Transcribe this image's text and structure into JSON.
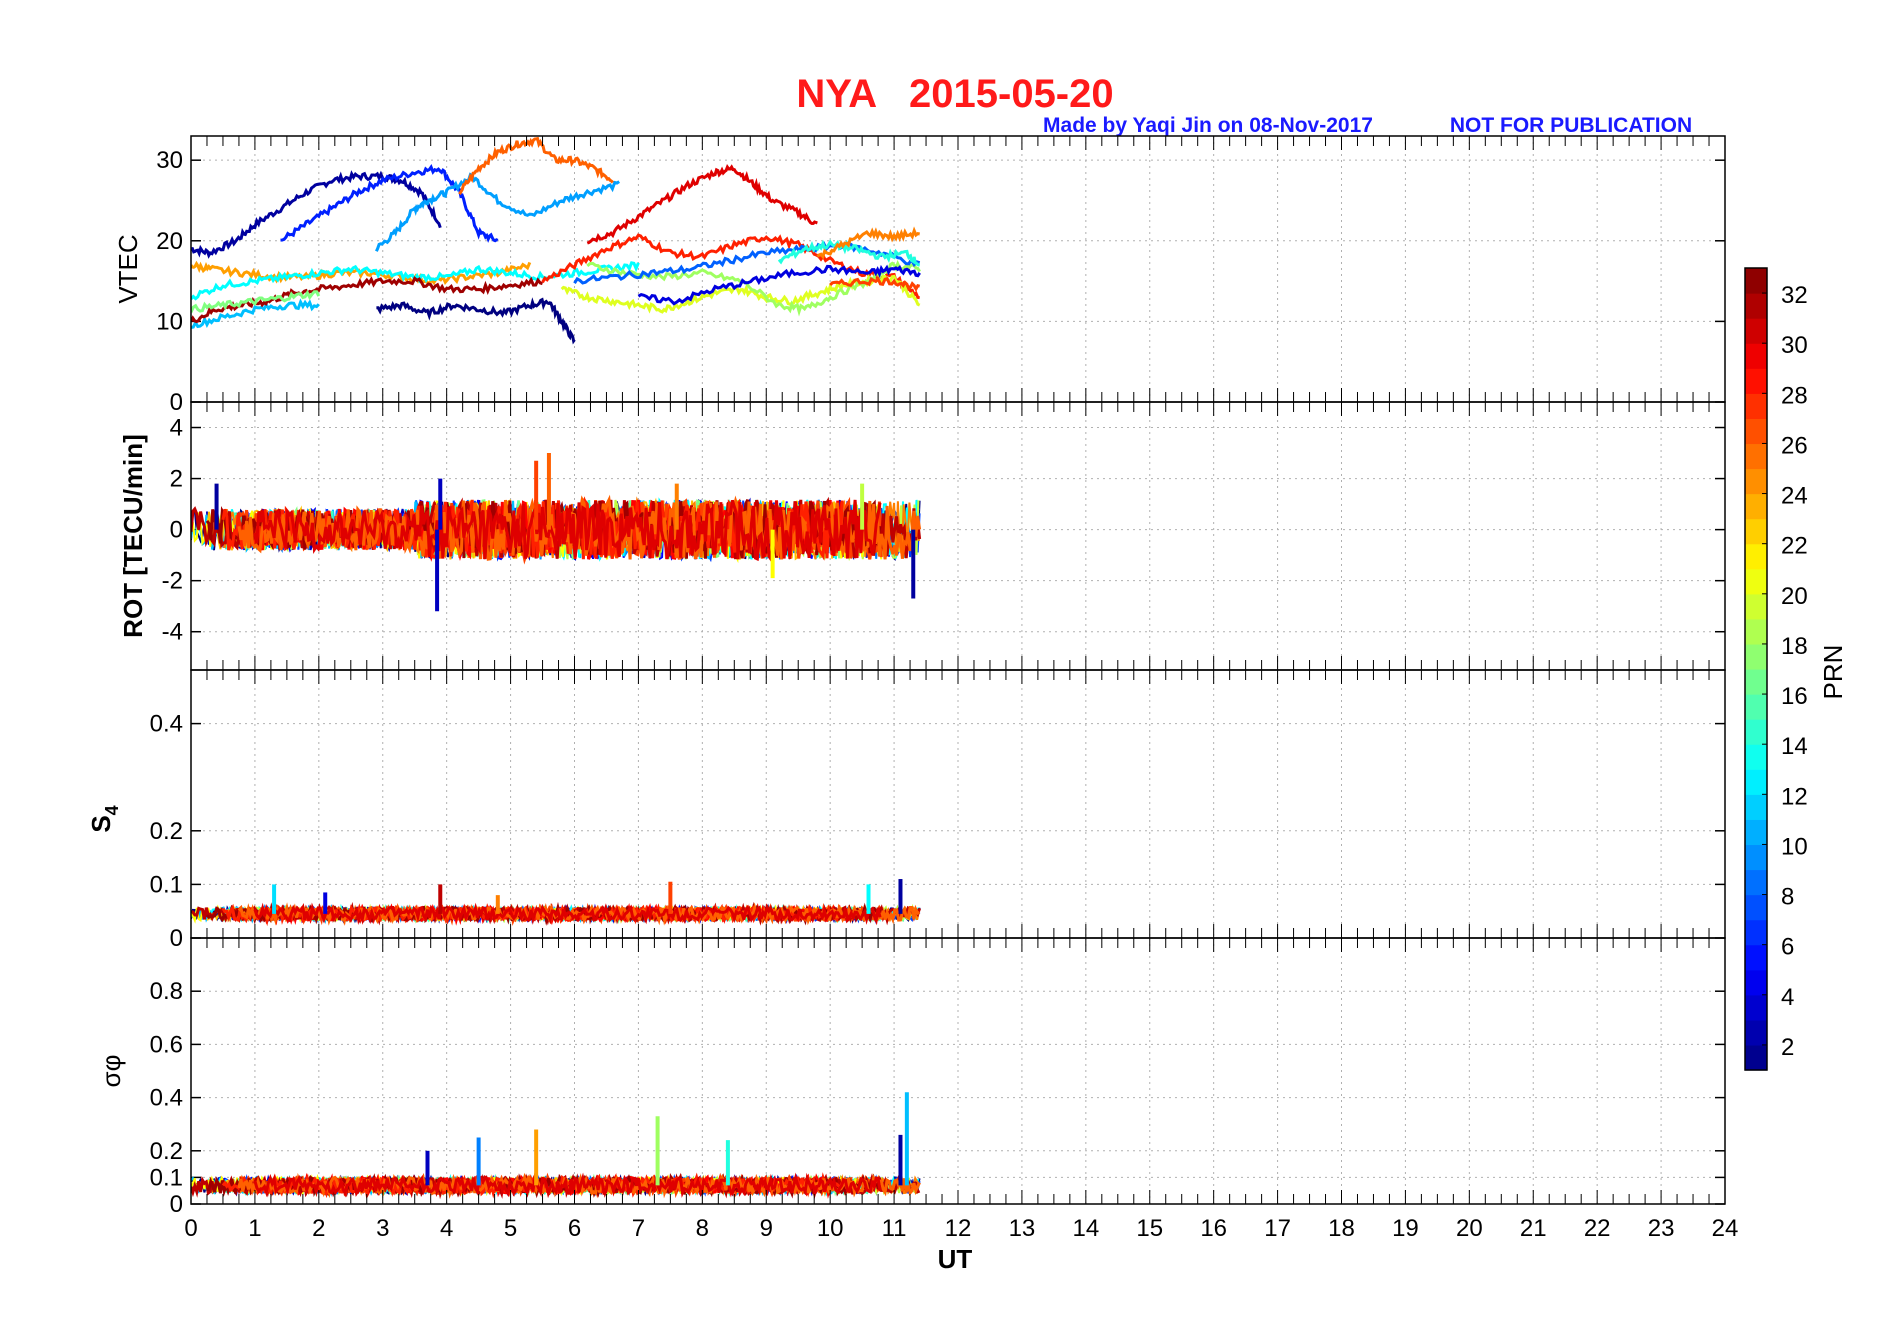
{
  "header": {
    "title": "NYA   2015-05-20",
    "credit": "Made by Yaqi Jin on 08-Nov-2017",
    "notice": "NOT FOR PUBLICATION"
  },
  "colors": {
    "title": "#ff1a1a",
    "credit": "#1a1aff",
    "frame": "#000000",
    "grid": "#b0b0b0"
  },
  "colormap": "jet",
  "chart_data": [
    {
      "type": "line",
      "ylabel": "VTEC",
      "x_range": [
        0,
        24
      ],
      "ylim": [
        0,
        33
      ],
      "yticks": [
        "0",
        "10",
        "20",
        "30"
      ],
      "grid": true,
      "series_description": "VTEC per PRN, colored by PRN, data from 0 to ~11.4 UT",
      "series": [
        {
          "prn": 2,
          "x": [
            0,
            0.3,
            0.7,
            1.0,
            1.4,
            1.8,
            2.2,
            2.6,
            3.0,
            3.3,
            3.6,
            3.9
          ],
          "y": [
            19,
            18.5,
            20,
            22,
            24,
            26,
            27.5,
            28,
            28,
            27.5,
            26,
            22
          ]
        },
        {
          "prn": 6,
          "x": [
            1.4,
            1.8,
            2.2,
            2.6,
            3.0,
            3.5,
            3.9,
            4.2,
            4.5,
            4.8
          ],
          "y": [
            20,
            22,
            24,
            26,
            27.5,
            28.5,
            29,
            26,
            21,
            20
          ]
        },
        {
          "prn": 10,
          "x": [
            2.9,
            3.2,
            3.5,
            3.7,
            4.0,
            4.4,
            4.8,
            5.3,
            5.8,
            6.2,
            6.7
          ],
          "y": [
            19,
            21,
            24,
            25,
            26,
            28,
            25,
            23,
            25,
            26,
            27
          ]
        },
        {
          "prn": 26,
          "x": [
            4.2,
            4.5,
            4.8,
            5.1,
            5.4,
            5.7,
            6.0,
            6.3,
            6.6
          ],
          "y": [
            26,
            29,
            31,
            32,
            32.5,
            30,
            30,
            29,
            27.5
          ]
        },
        {
          "prn": 30,
          "x": [
            6.2,
            6.6,
            7.0,
            7.4,
            7.8,
            8.2,
            8.5,
            8.8,
            9.1,
            9.5,
            9.8
          ],
          "y": [
            20,
            21,
            23,
            25,
            27,
            28.5,
            29,
            27,
            25,
            23.5,
            22
          ]
        },
        {
          "prn": 1,
          "x": [
            2.9,
            3.3,
            3.7,
            4.1,
            4.5,
            4.9,
            5.3,
            5.6,
            5.8,
            6.0
          ],
          "y": [
            11.5,
            12,
            11,
            12,
            11.5,
            11,
            12,
            12.5,
            10,
            7.5
          ]
        },
        {
          "prn": 24,
          "x": [
            0,
            0.3,
            0.8,
            1.3,
            1.8,
            2.3,
            2.8,
            3.3,
            3.8,
            4.3,
            4.8,
            5.3
          ],
          "y": [
            17,
            16.5,
            16,
            15.5,
            15.5,
            16,
            16,
            15.5,
            15,
            15.5,
            16,
            17
          ]
        },
        {
          "prn": 13,
          "x": [
            0,
            0.5,
            1.0,
            1.5,
            2.0,
            2.5,
            3.0,
            3.5,
            4.0,
            4.5,
            5.0,
            5.5,
            6.0,
            6.5,
            7.0
          ],
          "y": [
            13,
            14.5,
            15,
            15.5,
            16,
            16.5,
            16,
            15.5,
            15.5,
            16.5,
            16,
            15.5,
            16,
            16.5,
            17
          ]
        },
        {
          "prn": 11,
          "x": [
            0,
            0.5,
            1.0,
            1.5,
            2.0
          ],
          "y": [
            9.5,
            10.5,
            11.5,
            12,
            12
          ]
        },
        {
          "prn": 32,
          "x": [
            0,
            0.4,
            0.8,
            1.2,
            1.6,
            2.0,
            2.5,
            3.0,
            3.5,
            4.0,
            4.5,
            5.0,
            5.5
          ],
          "y": [
            10,
            11.5,
            12,
            12.5,
            13.5,
            14,
            14.5,
            15,
            15,
            14,
            14,
            14.5,
            15
          ]
        },
        {
          "prn": 17,
          "x": [
            0,
            0.5,
            1.0,
            1.5,
            2.0
          ],
          "y": [
            11.5,
            12,
            12.5,
            13,
            13.5
          ]
        },
        {
          "prn": 28,
          "x": [
            5.5,
            6.0,
            6.5,
            7.0,
            7.5,
            8.0,
            8.5,
            9.0,
            9.5,
            10.0,
            10.5,
            11.0,
            11.4
          ],
          "y": [
            15,
            17,
            19,
            20.5,
            18.5,
            18,
            19.5,
            20.5,
            19.5,
            17.5,
            16,
            15.5,
            13
          ]
        },
        {
          "prn": 20,
          "x": [
            5.8,
            6.2,
            6.6,
            7.0,
            7.4,
            7.8,
            8.2,
            8.6,
            9.0,
            9.4,
            9.8,
            10.2,
            10.6,
            11.0,
            11.4
          ],
          "y": [
            14,
            13,
            12.5,
            12,
            11.5,
            12.5,
            13.5,
            14,
            13,
            12.5,
            13.5,
            14.5,
            15,
            15.5,
            12
          ]
        },
        {
          "prn": 18,
          "x": [
            6.2,
            6.8,
            7.4,
            8.0,
            8.6,
            9.2,
            9.6,
            10.0,
            10.6,
            11.0,
            11.4
          ],
          "y": [
            17,
            16,
            15.5,
            16,
            15,
            12,
            11.5,
            13,
            15,
            17,
            16.5
          ]
        },
        {
          "prn": 8,
          "x": [
            6.0,
            6.6,
            7.2,
            7.8,
            8.4,
            9.0,
            9.6,
            10.2,
            10.8,
            11.4
          ],
          "y": [
            15,
            15.5,
            16,
            16.5,
            17.5,
            18.5,
            19,
            19.5,
            18.5,
            17
          ]
        },
        {
          "prn": 14,
          "x": [
            9.2,
            9.6,
            10.0,
            10.4,
            10.8,
            11.2,
            11.4
          ],
          "y": [
            17.5,
            19,
            19.5,
            19,
            18,
            18.5,
            17
          ]
        },
        {
          "prn": 4,
          "x": [
            7.0,
            7.6,
            8.2,
            8.8,
            9.4,
            10.0,
            10.6,
            11.0,
            11.4
          ],
          "y": [
            13,
            12.5,
            14,
            15,
            16,
            16.5,
            16,
            16.5,
            16
          ]
        },
        {
          "prn": 25,
          "x": [
            9.8,
            10.2,
            10.6,
            11.0,
            11.4
          ],
          "y": [
            18,
            19.5,
            21,
            20.5,
            21
          ]
        },
        {
          "prn": 27,
          "x": [
            10.0,
            10.5,
            11.0,
            11.4
          ],
          "y": [
            14.5,
            15,
            15,
            14
          ]
        }
      ]
    },
    {
      "type": "line",
      "ylabel": "ROT [TECU/min]",
      "x_range": [
        0,
        24
      ],
      "ylim": [
        -5.5,
        5
      ],
      "yticks": [
        "-4",
        "-2",
        "0",
        "2",
        "4"
      ],
      "grid": true,
      "series_description": "Noisy ROT traces per PRN around 0, max spikes ~3 and min ~-3",
      "spikes": [
        {
          "prn": 3,
          "x": 3.85,
          "y": -3.2
        },
        {
          "prn": 3,
          "x": 3.9,
          "y": 2.0
        },
        {
          "prn": 26,
          "x": 5.6,
          "y": 3.0
        },
        {
          "prn": 27,
          "x": 5.4,
          "y": 2.7
        },
        {
          "prn": 2,
          "x": 11.3,
          "y": -2.7
        },
        {
          "prn": 2,
          "x": 0.4,
          "y": 1.8
        },
        {
          "prn": 21,
          "x": 9.1,
          "y": -1.9
        },
        {
          "prn": 25,
          "x": 7.6,
          "y": 1.8
        },
        {
          "prn": 19,
          "x": 10.5,
          "y": 1.8
        }
      ]
    },
    {
      "type": "line",
      "ylabel": "S4",
      "x_range": [
        0,
        24
      ],
      "ylim": [
        0,
        0.5
      ],
      "yticks": [
        "0",
        "0.1",
        "0.2",
        "0.4"
      ],
      "grid": true,
      "series_description": "S4 index per PRN, mostly 0.03-0.06 with peaks ~0.1",
      "peaks": [
        {
          "prn": 12,
          "x": 1.3,
          "y": 0.1
        },
        {
          "prn": 4,
          "x": 2.1,
          "y": 0.085
        },
        {
          "prn": 31,
          "x": 3.9,
          "y": 0.1
        },
        {
          "prn": 27,
          "x": 7.5,
          "y": 0.105
        },
        {
          "prn": 2,
          "x": 11.1,
          "y": 0.11
        },
        {
          "prn": 13,
          "x": 10.6,
          "y": 0.1
        },
        {
          "prn": 25,
          "x": 4.8,
          "y": 0.08
        }
      ]
    },
    {
      "type": "line",
      "ylabel": "σφ",
      "x_range": [
        0,
        24
      ],
      "ylim": [
        0,
        1
      ],
      "yticks": [
        "0",
        "0.1",
        "0.2",
        "0.4",
        "0.6",
        "0.8"
      ],
      "grid": true,
      "series_description": "Phase scintillation index per PRN, mostly ~0.05-0.1 with peaks",
      "peaks": [
        {
          "prn": 11,
          "x": 11.2,
          "y": 0.42
        },
        {
          "prn": 18,
          "x": 7.3,
          "y": 0.33
        },
        {
          "prn": 24,
          "x": 5.4,
          "y": 0.28
        },
        {
          "prn": 3,
          "x": 3.7,
          "y": 0.2
        },
        {
          "prn": 9,
          "x": 4.5,
          "y": 0.25
        },
        {
          "prn": 14,
          "x": 8.4,
          "y": 0.24
        },
        {
          "prn": 2,
          "x": 11.1,
          "y": 0.26
        }
      ]
    }
  ],
  "xaxis": {
    "label": "UT",
    "ticks": [
      "0",
      "1",
      "2",
      "3",
      "4",
      "5",
      "6",
      "7",
      "8",
      "9",
      "10",
      "11",
      "12",
      "13",
      "14",
      "15",
      "16",
      "17",
      "18",
      "19",
      "20",
      "21",
      "22",
      "23",
      "24"
    ]
  },
  "colorbar": {
    "label": "PRN",
    "range": [
      1,
      33
    ],
    "ticks": [
      "2",
      "4",
      "6",
      "8",
      "10",
      "12",
      "14",
      "16",
      "18",
      "20",
      "22",
      "24",
      "26",
      "28",
      "30",
      "32"
    ]
  }
}
